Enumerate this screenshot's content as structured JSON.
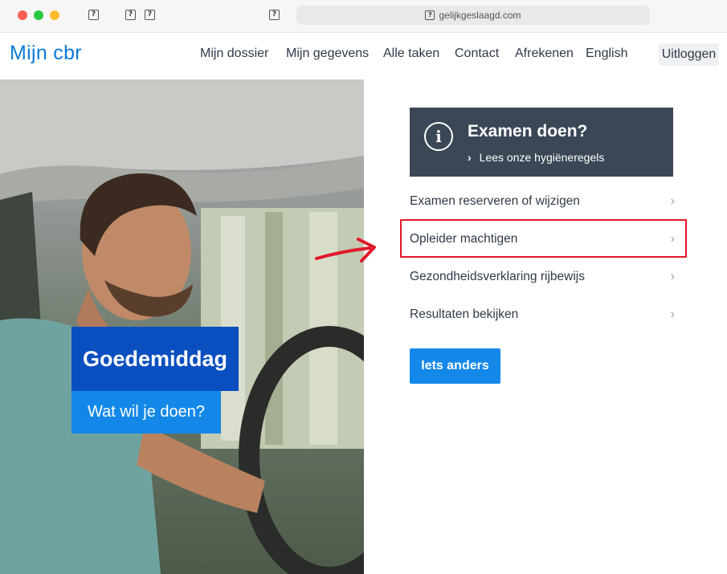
{
  "browser": {
    "url": "gelijkgeslaagd.com"
  },
  "header": {
    "logo": "Mijn cbr",
    "nav": [
      "Mijn dossier",
      "Mijn gegevens",
      "Alle taken",
      "Contact",
      "Afrekenen",
      "English"
    ],
    "logout": "Uitloggen"
  },
  "hero": {
    "greeting": "Goedemiddag",
    "question": "Wat wil je doen?"
  },
  "notice": {
    "title": "Examen doen?",
    "link": "Lees onze hygiëneregels"
  },
  "tasks": [
    "Examen reserveren of wijzigen",
    "Opleider machtigen",
    "Gezondheidsverklaring rijbewijs",
    "Resultaten bekijken"
  ],
  "other_button": "Iets anders",
  "colors": {
    "brand": "#0b7bd6",
    "greeting_bg": "#0a4fc0",
    "button_bg": "#1388e8",
    "notice_bg": "#3b4756",
    "annotation": "#e0192a"
  }
}
